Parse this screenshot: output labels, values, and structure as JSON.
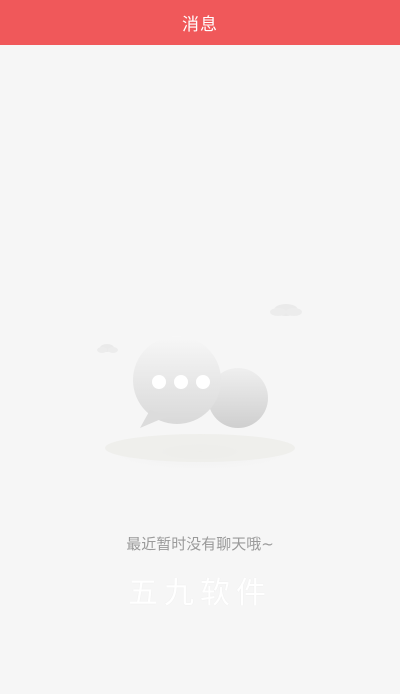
{
  "header": {
    "title": "消息"
  },
  "empty_state": {
    "message": "最近暂时没有聊天哦~",
    "illustration_icon": "chat-bubble-icon"
  },
  "watermark": {
    "text": "五九软件"
  },
  "colors": {
    "header_bg": "#f0585a",
    "page_bg": "#f6f6f6",
    "muted_text": "#9a9a9a"
  }
}
